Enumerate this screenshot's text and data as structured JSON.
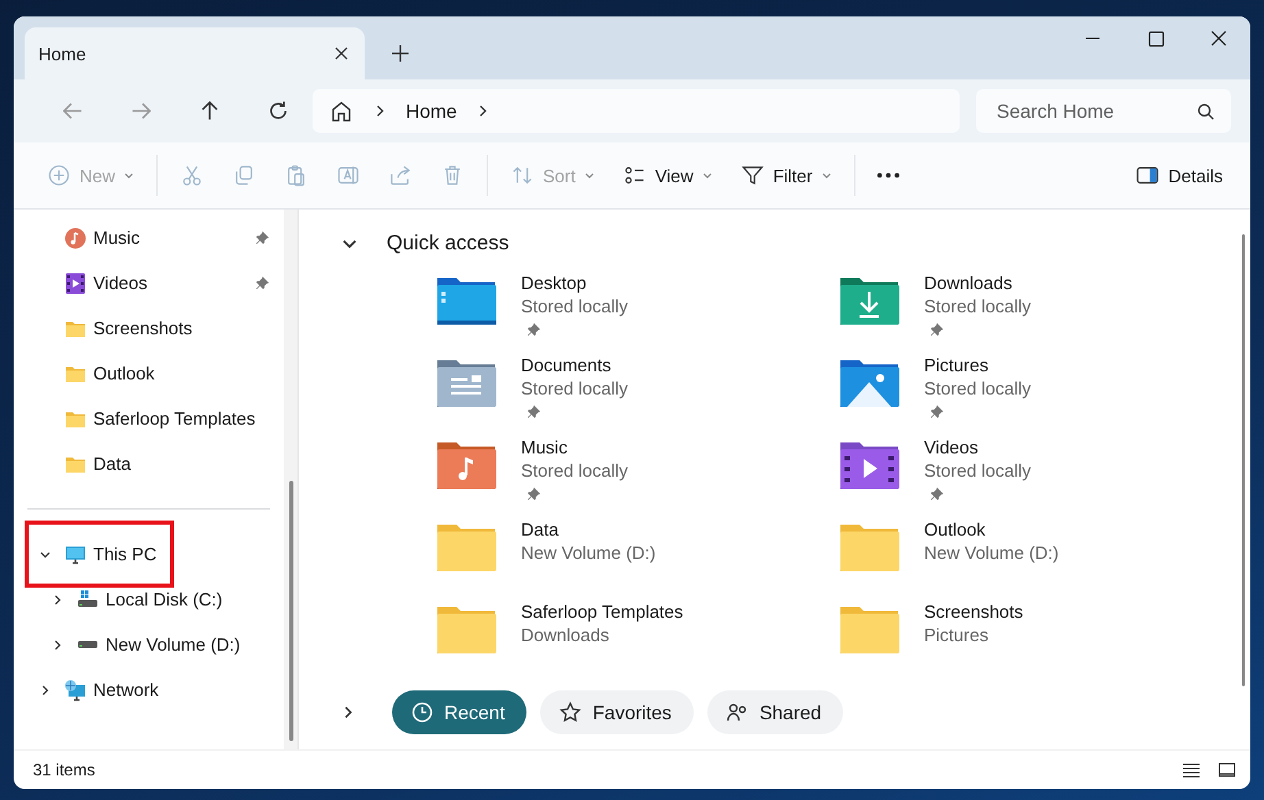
{
  "window": {
    "tabs": [
      {
        "label": "Home",
        "selected": true
      }
    ]
  },
  "nav": {
    "breadcrumb": [
      "Home"
    ],
    "search": {
      "placeholder": "Search Home"
    }
  },
  "toolbar": [
    {
      "kind": "new",
      "label": "New",
      "disabled": true,
      "dropdown": true
    },
    {
      "kind": "separator"
    },
    {
      "kind": "cut",
      "disabled": true
    },
    {
      "kind": "copy",
      "disabled": true
    },
    {
      "kind": "paste",
      "disabled": true
    },
    {
      "kind": "rename",
      "disabled": true
    },
    {
      "kind": "share",
      "disabled": true
    },
    {
      "kind": "delete",
      "disabled": true
    },
    {
      "kind": "separator"
    },
    {
      "kind": "sort",
      "label": "Sort",
      "disabled": true,
      "dropdown": true
    },
    {
      "kind": "view",
      "label": "View",
      "disabled": false,
      "dropdown": true
    },
    {
      "kind": "filter",
      "label": "Filter",
      "disabled": false,
      "dropdown": true
    },
    {
      "kind": "separator"
    },
    {
      "kind": "more",
      "disabled": false
    }
  ],
  "details_button": {
    "label": "Details"
  },
  "sidebar": {
    "sections": [
      {
        "items": [
          {
            "label": "Music",
            "kind": "music",
            "pinned": true
          },
          {
            "label": "Videos",
            "kind": "videos",
            "pinned": true
          },
          {
            "label": "Screenshots",
            "kind": "folder",
            "pinned": false
          },
          {
            "label": "Outlook",
            "kind": "folder",
            "pinned": false
          },
          {
            "label": "Saferloop Templates",
            "kind": "folder",
            "pinned": false
          },
          {
            "label": "Data",
            "kind": "folder",
            "pinned": false
          }
        ]
      },
      {
        "items": [
          {
            "label": "This PC",
            "kind": "pc",
            "expanded": true,
            "highlighted": true,
            "children": [
              {
                "label": "Local Disk (C:)",
                "kind": "system-drive",
                "expanded": false,
                "highlighted": false
              },
              {
                "label": "New Volume (D:)",
                "kind": "drive",
                "expanded": false,
                "highlighted": false
              }
            ]
          },
          {
            "label": "Network",
            "kind": "network",
            "expanded": false,
            "highlighted": false
          }
        ]
      }
    ]
  },
  "quick_access": {
    "title": "Quick access",
    "expanded": true,
    "items": [
      {
        "name": "Desktop",
        "location": "Stored locally",
        "kind": "desktop",
        "pinned": true
      },
      {
        "name": "Downloads",
        "location": "Stored locally",
        "kind": "downloads",
        "pinned": true
      },
      {
        "name": "Documents",
        "location": "Stored locally",
        "kind": "documents",
        "pinned": true
      },
      {
        "name": "Pictures",
        "location": "Stored locally",
        "kind": "pictures",
        "pinned": true
      },
      {
        "name": "Music",
        "location": "Stored locally",
        "kind": "music",
        "pinned": true
      },
      {
        "name": "Videos",
        "location": "Stored locally",
        "kind": "videos",
        "pinned": true
      },
      {
        "name": "Data",
        "location": "New Volume (D:)",
        "kind": "folder",
        "pinned": false
      },
      {
        "name": "Outlook",
        "location": "New Volume (D:)",
        "kind": "folder",
        "pinned": false
      },
      {
        "name": "Saferloop Templates",
        "location": "Downloads",
        "kind": "folder",
        "pinned": false
      },
      {
        "name": "Screenshots",
        "location": "Pictures",
        "kind": "folder",
        "pinned": false
      }
    ]
  },
  "recent_section": {
    "expanded": false,
    "tabs": [
      {
        "label": "Recent",
        "kind": "recent",
        "selected": true
      },
      {
        "label": "Favorites",
        "kind": "favorites",
        "selected": false
      },
      {
        "label": "Shared",
        "kind": "shared",
        "selected": false
      }
    ]
  },
  "status_bar": {
    "count": "31 items"
  }
}
